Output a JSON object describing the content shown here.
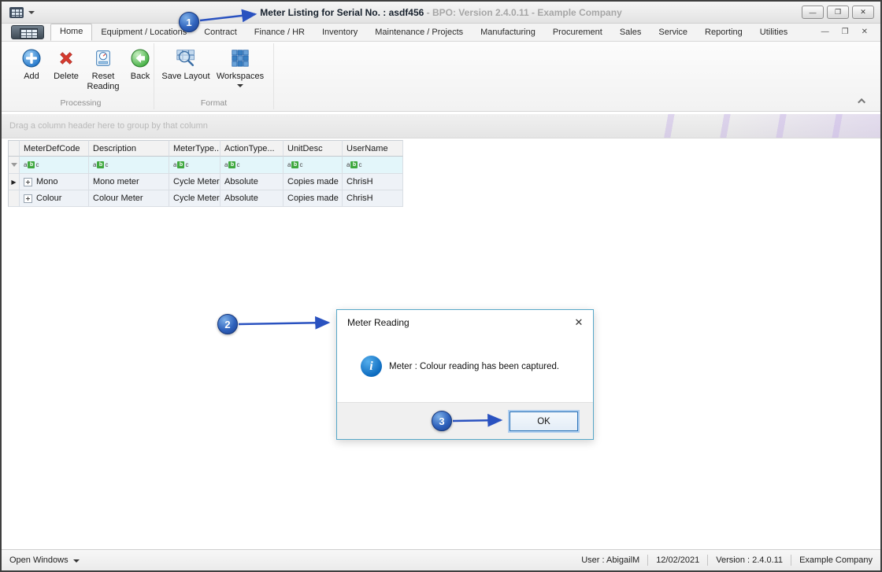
{
  "titlebar": {
    "title_main": "Meter Listing for Serial No. : asdf456",
    "title_suffix": " - BPO: Version 2.4.0.11 - Example Company"
  },
  "icons": {
    "minimize": "—",
    "maximize": "❐",
    "close": "✕",
    "row_arrow": "▶"
  },
  "ribbon": {
    "tabs": [
      {
        "label": "Home"
      },
      {
        "label": "Equipment / Locations"
      },
      {
        "label": "Contract"
      },
      {
        "label": "Finance / HR"
      },
      {
        "label": "Inventory"
      },
      {
        "label": "Maintenance / Projects"
      },
      {
        "label": "Manufacturing"
      },
      {
        "label": "Procurement"
      },
      {
        "label": "Sales"
      },
      {
        "label": "Service"
      },
      {
        "label": "Reporting"
      },
      {
        "label": "Utilities"
      }
    ],
    "groups": [
      {
        "label": "Processing",
        "buttons": [
          {
            "label": "Add"
          },
          {
            "label": "Delete"
          },
          {
            "label": "Reset Reading"
          },
          {
            "label": "Back"
          }
        ]
      },
      {
        "label": "Format",
        "buttons": [
          {
            "label": "Save Layout"
          },
          {
            "label": "Workspaces"
          }
        ]
      }
    ]
  },
  "grid": {
    "group_hint": "Drag a column header here to group by that column",
    "columns": [
      "MeterDefCode",
      "Description",
      "MeterType...",
      "ActionType...",
      "UnitDesc",
      "UserName"
    ],
    "filter_icon": [
      "a",
      "b",
      "c"
    ],
    "rows": [
      [
        "Mono",
        "Mono meter",
        "Cycle Meter",
        "Absolute",
        "Copies made",
        "ChrisH"
      ],
      [
        "Colour",
        "Colour Meter",
        "Cycle Meter",
        "Absolute",
        "Copies made",
        "ChrisH"
      ]
    ]
  },
  "dialog": {
    "title": "Meter Reading",
    "message": "Meter : Colour reading has been captured.",
    "ok_label": "OK",
    "info_glyph": "i",
    "close_icon": "✕"
  },
  "annotations": [
    {
      "number": "1"
    },
    {
      "number": "2"
    },
    {
      "number": "3"
    }
  ],
  "statusbar": {
    "open_windows": "Open Windows",
    "user": "User : AbigailM",
    "date": "12/02/2021",
    "version": "Version : 2.4.0.11",
    "company": "Example Company"
  }
}
